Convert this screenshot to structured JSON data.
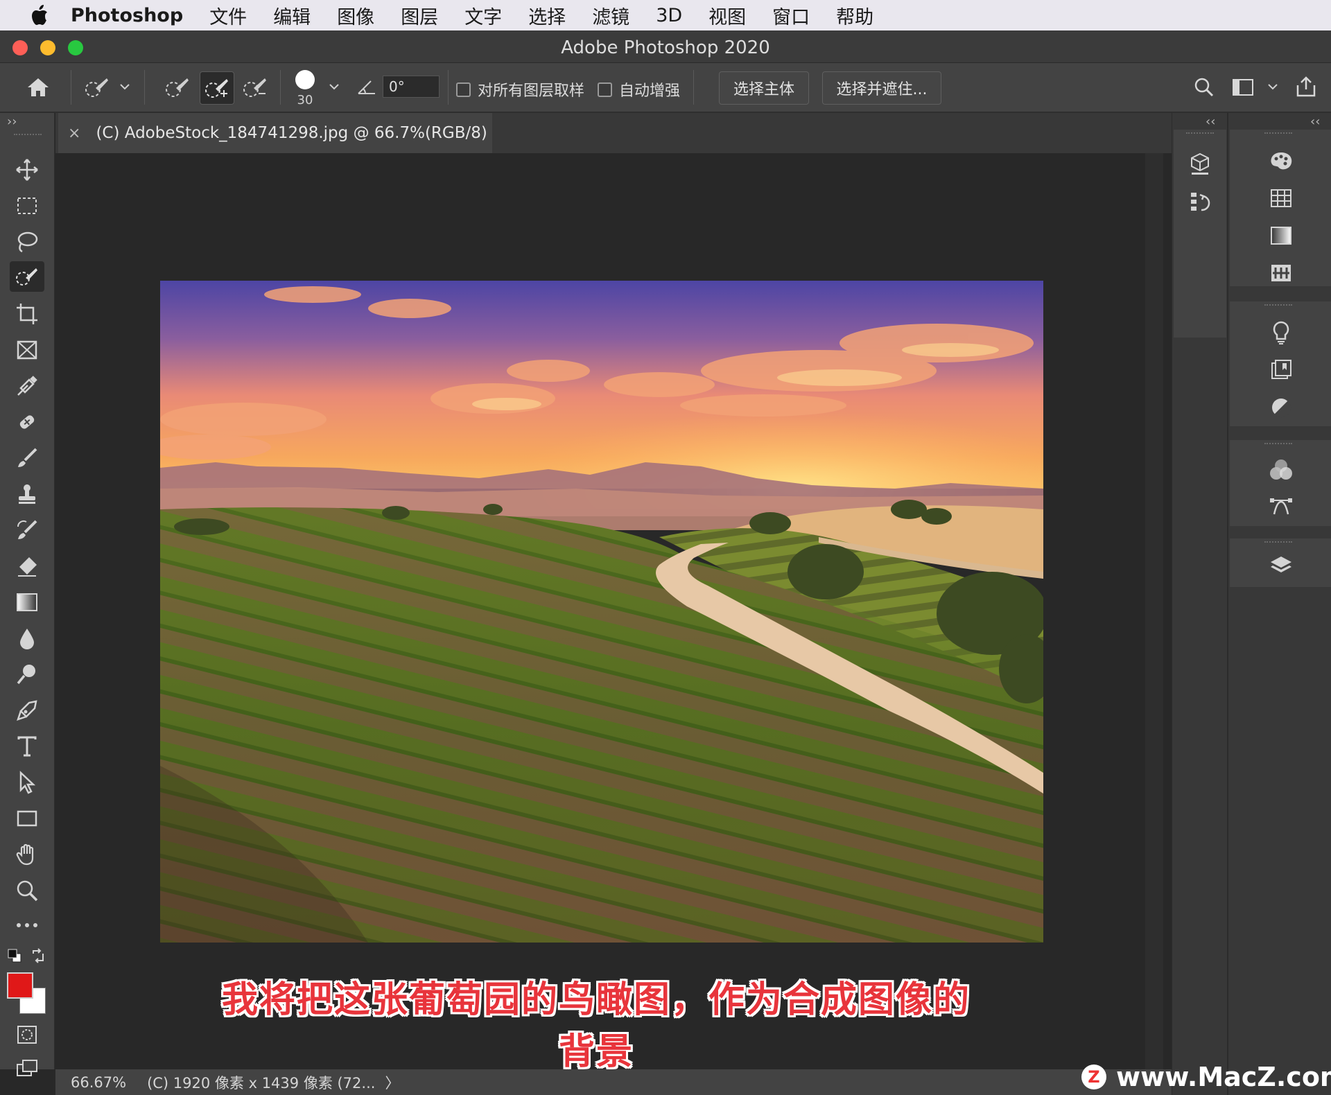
{
  "menubar": {
    "app_name": "Photoshop",
    "items": [
      "文件",
      "编辑",
      "图像",
      "图层",
      "文字",
      "选择",
      "滤镜",
      "3D",
      "视图",
      "窗口",
      "帮助"
    ]
  },
  "window": {
    "title": "Adobe Photoshop 2020"
  },
  "options_bar": {
    "brush_size": "30",
    "angle_value": "0°",
    "sample_all_layers_label": "对所有图层取样",
    "auto_enhance_label": "自动增强",
    "select_subject_label": "选择主体",
    "select_and_mask_label": "选择并遮住..."
  },
  "document_tab": {
    "close_glyph": "×",
    "title": "(C) AdobeStock_184741298.jpg @ 66.7%(RGB/8)"
  },
  "caption": "我将把这张葡萄园的鸟瞰图，作为合成图像的背景",
  "status_bar": {
    "zoom": "66.67%",
    "doc_info": "(C) 1920 像素 x 1439 像素 (72...",
    "arrow": "〉"
  },
  "colors": {
    "foreground": "#e01818",
    "background": "#ffffff"
  },
  "watermark": {
    "badge": "Z",
    "text": "www.MacZ.com"
  },
  "collapse_glyphs": {
    "left": "››",
    "right1": "‹‹",
    "right2": "‹‹"
  }
}
